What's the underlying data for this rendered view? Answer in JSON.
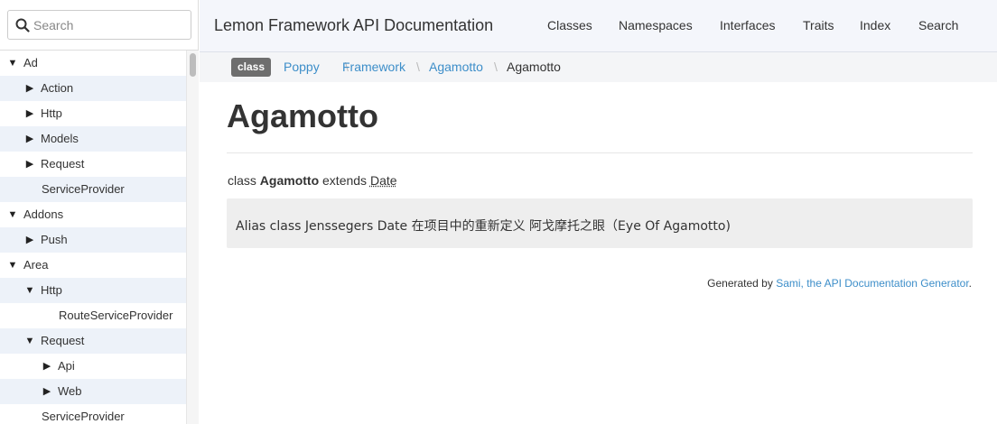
{
  "search": {
    "placeholder": "Search"
  },
  "tree": [
    {
      "label": "Ad",
      "state": "open",
      "depth": 0
    },
    {
      "label": "Action",
      "state": "closed",
      "depth": 1
    },
    {
      "label": "Http",
      "state": "closed",
      "depth": 1
    },
    {
      "label": "Models",
      "state": "closed",
      "depth": 1
    },
    {
      "label": "Request",
      "state": "closed",
      "depth": 1
    },
    {
      "label": "ServiceProvider",
      "state": "leaf",
      "depth": 1
    },
    {
      "label": "Addons",
      "state": "open",
      "depth": 0
    },
    {
      "label": "Push",
      "state": "closed",
      "depth": 1
    },
    {
      "label": "Area",
      "state": "open",
      "depth": 0
    },
    {
      "label": "Http",
      "state": "open",
      "depth": 1
    },
    {
      "label": "RouteServiceProvider",
      "state": "leaf",
      "depth": 2
    },
    {
      "label": "Request",
      "state": "open",
      "depth": 1
    },
    {
      "label": "Api",
      "state": "closed",
      "depth": 2
    },
    {
      "label": "Web",
      "state": "closed",
      "depth": 2
    },
    {
      "label": "ServiceProvider",
      "state": "leaf",
      "depth": 1
    }
  ],
  "navbar": {
    "brand": "Lemon Framework API Documentation",
    "links": [
      "Classes",
      "Namespaces",
      "Interfaces",
      "Traits",
      "Index",
      "Search"
    ]
  },
  "breadcrumbs": {
    "badge": "class",
    "items": [
      "Poppy",
      "Framework",
      "Agamotto"
    ],
    "current": "Agamotto",
    "separator": "\\"
  },
  "page": {
    "title": "Agamotto",
    "signature_prefix": "class",
    "class_name": "Agamotto",
    "extends_word": "extends",
    "parent_class": "Date",
    "description": "Alias class Jenssegers Date 在项目中的重新定义 阿戈摩托之眼（Eye Of Agamotto)"
  },
  "footer": {
    "prefix": "Generated by ",
    "link": "Sami, the API Documentation Generator",
    "suffix": "."
  },
  "colors": {
    "link": "#3d8ec9",
    "badge": "#6e6e6e",
    "navbar_bg": "#f4f6fb",
    "row_shade": "#edf2f9"
  }
}
